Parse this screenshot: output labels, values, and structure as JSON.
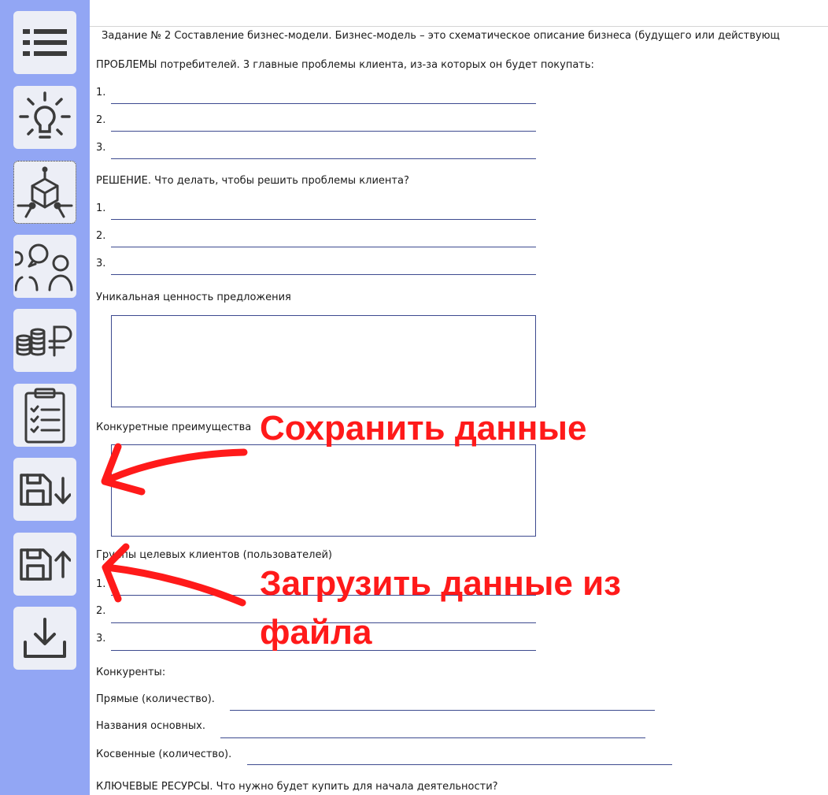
{
  "sidebar": {
    "buttons": [
      {
        "icon": "menu-icon"
      },
      {
        "icon": "lightbulb-icon"
      },
      {
        "icon": "cube-network-icon"
      },
      {
        "icon": "people-chat-icon"
      },
      {
        "icon": "coins-ruble-icon"
      },
      {
        "icon": "clipboard-icon"
      },
      {
        "icon": "save-down-icon"
      },
      {
        "icon": "save-up-icon"
      },
      {
        "icon": "download-icon"
      }
    ]
  },
  "form": {
    "title": "Задание № 2 Составление бизнес-модели. Бизнес-модель – это схематическое описание бизнеса (будущего или действующ",
    "problems_label": "ПРОБЛЕМЫ потребителей. 3 главные проблемы клиента, из-за которых он будет покупать:",
    "solution_label": "РЕШЕНИЕ. Что делать, чтобы решить проблемы клиента?",
    "unique_value_label": "Уникальная ценность предложения",
    "competitive_adv_label": "Конкуретные преимущества",
    "target_groups_label": "Группы целевых клиентов (пользователей)",
    "competitors_label": "Конкуренты:",
    "direct_label": "Прямые (количество).",
    "names_label": "Названия основных.",
    "indirect_label": "Косвенные (количество).",
    "key_resources_label": "КЛЮЧЕВЫЕ  РЕСУРСЫ. Что нужно будет купить для начала деятельности?",
    "n1": "1.",
    "n2": "2.",
    "n3": "3."
  },
  "annotations": {
    "save": "Сохранить данные",
    "load_line1": "Загрузить данные из",
    "load_line2": "файла",
    "color": "#ff1a1a"
  }
}
